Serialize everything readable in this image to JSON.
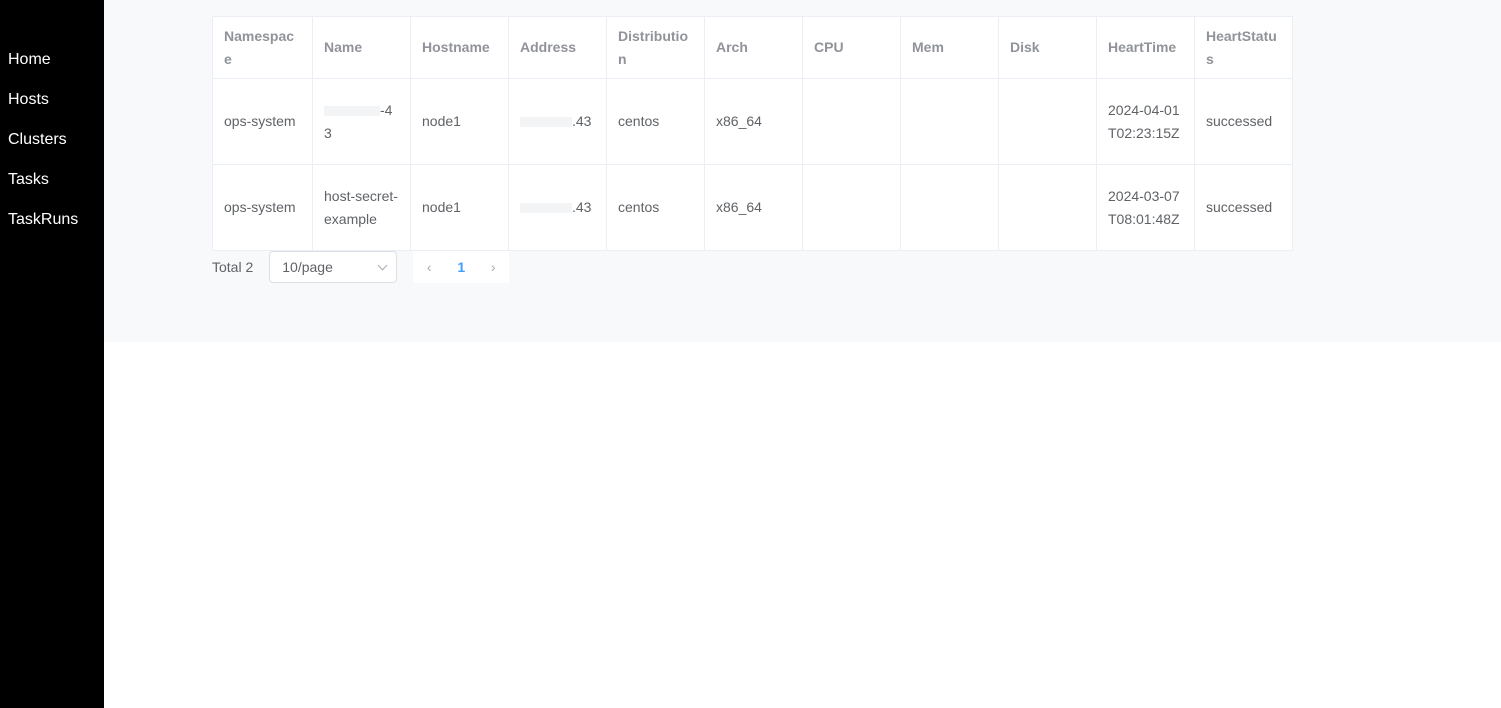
{
  "nav": {
    "items": [
      "Home",
      "Hosts",
      "Clusters",
      "Tasks",
      "TaskRuns"
    ]
  },
  "table": {
    "columns": [
      "Namespace",
      "Name",
      "Hostname",
      "Address",
      "Distribution",
      "Arch",
      "CPU",
      "Mem",
      "Disk",
      "HeartTime",
      "HeartStatus"
    ],
    "rows": [
      {
        "namespace": "ops-system",
        "name_suffix": "-43",
        "hostname": "node1",
        "address_suffix": ".43",
        "distribution": "centos",
        "arch": "x86_64",
        "cpu": "",
        "mem": "",
        "disk": "",
        "heart_time": "2024-04-01T02:23:15Z",
        "heart_status": "successed"
      },
      {
        "namespace": "ops-system",
        "name": "host-secret-example",
        "hostname": "node1",
        "address_suffix": ".43",
        "distribution": "centos",
        "arch": "x86_64",
        "cpu": "",
        "mem": "",
        "disk": "",
        "heart_time": "2024-03-07T08:01:48Z",
        "heart_status": "successed"
      }
    ]
  },
  "pagination": {
    "total_label": "Total 2",
    "page_size": "10/page",
    "current_page": "1",
    "prev_icon": "‹",
    "next_icon": "›"
  },
  "colors": {
    "sidebar_bg": "#000000",
    "main_bg": "#f8f9fb",
    "accent": "#409eff"
  }
}
